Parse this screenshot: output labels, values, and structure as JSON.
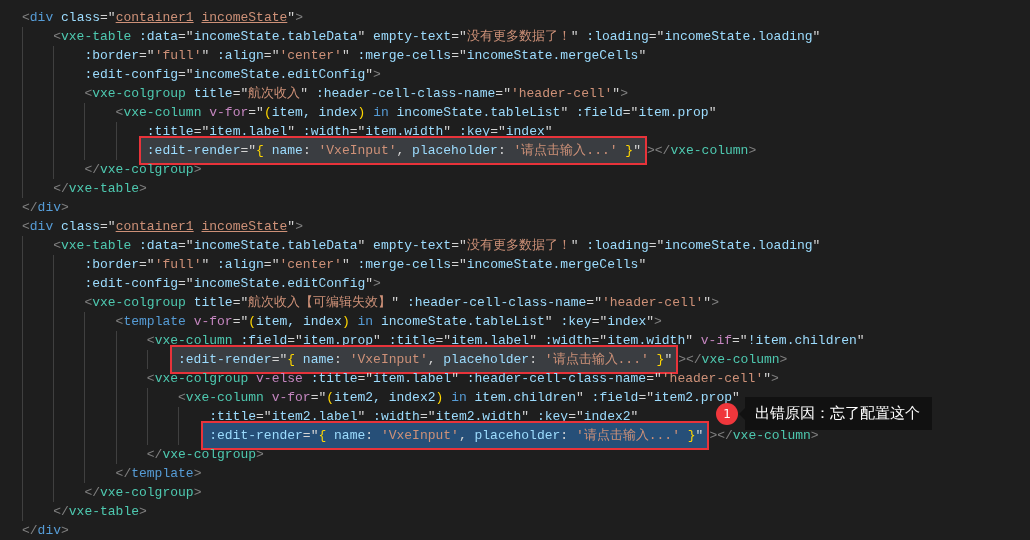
{
  "editor": {
    "lines": [
      {
        "tokens": [
          {
            "kind": "bracket",
            "text": "<"
          },
          {
            "kind": "tag",
            "text": "div"
          },
          {
            "kind": "attr",
            "text": " class"
          },
          {
            "kind": "plain",
            "text": "=\""
          },
          {
            "kind": "string_underlined",
            "text": "container1"
          },
          {
            "kind": "string_underlined",
            "text": " incomeState"
          },
          {
            "kind": "plain",
            "text": "\""
          },
          {
            "kind": "bracket",
            "text": ">"
          }
        ],
        "children": [
          {
            "tokens": [
              {
                "kind": "bracket",
                "text": "<"
              },
              {
                "kind": "component",
                "text": "vxe-table"
              },
              {
                "kind": "attr",
                "text": " :data"
              },
              {
                "kind": "plain",
                "text": "=\""
              },
              {
                "kind": "expr",
                "text": "incomeState.tableData"
              },
              {
                "kind": "plain",
                "text": "\" "
              },
              {
                "kind": "attr",
                "text": "empty-text"
              },
              {
                "kind": "plain",
                "text": "=\""
              },
              {
                "kind": "string",
                "text": "没有更多数据了！"
              },
              {
                "kind": "plain",
                "text": "\" "
              },
              {
                "kind": "attr",
                "text": ":loading"
              },
              {
                "kind": "plain",
                "text": "=\""
              },
              {
                "kind": "expr",
                "text": "incomeState.loading"
              },
              {
                "kind": "plain",
                "text": "\""
              }
            ],
            "children": [
              {
                "tokens": [
                  {
                    "kind": "attr",
                    "text": ":border"
                  },
                  {
                    "kind": "plain",
                    "text": "=\""
                  },
                  {
                    "kind": "string",
                    "text": "'full'"
                  },
                  {
                    "kind": "plain",
                    "text": "\" "
                  },
                  {
                    "kind": "attr",
                    "text": ":align"
                  },
                  {
                    "kind": "plain",
                    "text": "=\""
                  },
                  {
                    "kind": "string",
                    "text": "'center'"
                  },
                  {
                    "kind": "plain",
                    "text": "\" "
                  },
                  {
                    "kind": "attr",
                    "text": ":merge-cells"
                  },
                  {
                    "kind": "plain",
                    "text": "=\""
                  },
                  {
                    "kind": "expr",
                    "text": "incomeState.mergeCells"
                  },
                  {
                    "kind": "plain",
                    "text": "\""
                  }
                ]
              },
              {
                "tokens": [
                  {
                    "kind": "attr",
                    "text": ":edit-config"
                  },
                  {
                    "kind": "plain",
                    "text": "=\""
                  },
                  {
                    "kind": "expr",
                    "text": "incomeState.editConfig"
                  },
                  {
                    "kind": "plain",
                    "text": "\""
                  },
                  {
                    "kind": "bracket",
                    "text": ">"
                  }
                ]
              },
              {
                "tokens": [
                  {
                    "kind": "bracket",
                    "text": "<"
                  },
                  {
                    "kind": "component",
                    "text": "vxe-colgroup"
                  },
                  {
                    "kind": "attr",
                    "text": " title"
                  },
                  {
                    "kind": "plain",
                    "text": "=\""
                  },
                  {
                    "kind": "string",
                    "text": "航次收入"
                  },
                  {
                    "kind": "plain",
                    "text": "\" "
                  },
                  {
                    "kind": "attr",
                    "text": ":header-cell-class-name"
                  },
                  {
                    "kind": "plain",
                    "text": "=\""
                  },
                  {
                    "kind": "string",
                    "text": "'header-cell'"
                  },
                  {
                    "kind": "plain",
                    "text": "\""
                  },
                  {
                    "kind": "bracket",
                    "text": ">"
                  }
                ],
                "children": [
                  {
                    "tokens": [
                      {
                        "kind": "bracket",
                        "text": "<"
                      },
                      {
                        "kind": "component",
                        "text": "vxe-column"
                      },
                      {
                        "kind": "directive",
                        "text": " v-for"
                      },
                      {
                        "kind": "plain",
                        "text": "=\""
                      },
                      {
                        "kind": "brace",
                        "text": "("
                      },
                      {
                        "kind": "expr",
                        "text": "item, index"
                      },
                      {
                        "kind": "brace",
                        "text": ")"
                      },
                      {
                        "kind": "keyword",
                        "text": " in"
                      },
                      {
                        "kind": "expr",
                        "text": " incomeState.tableList"
                      },
                      {
                        "kind": "plain",
                        "text": "\" "
                      },
                      {
                        "kind": "attr",
                        "text": ":field"
                      },
                      {
                        "kind": "plain",
                        "text": "=\""
                      },
                      {
                        "kind": "expr",
                        "text": "item.prop"
                      },
                      {
                        "kind": "plain",
                        "text": "\""
                      }
                    ],
                    "children": [
                      {
                        "tokens": [
                          {
                            "kind": "attr",
                            "text": ":title"
                          },
                          {
                            "kind": "plain",
                            "text": "=\""
                          },
                          {
                            "kind": "expr",
                            "text": "item.label"
                          },
                          {
                            "kind": "plain",
                            "text": "\" "
                          },
                          {
                            "kind": "attr",
                            "text": ":width"
                          },
                          {
                            "kind": "plain",
                            "text": "=\""
                          },
                          {
                            "kind": "expr",
                            "text": "item.width"
                          },
                          {
                            "kind": "plain",
                            "text": "\" "
                          },
                          {
                            "kind": "attr",
                            "text": ":key"
                          },
                          {
                            "kind": "plain",
                            "text": "=\""
                          },
                          {
                            "kind": "expr",
                            "text": "index"
                          },
                          {
                            "kind": "plain",
                            "text": "\""
                          }
                        ]
                      },
                      {
                        "marked": {
                          "selected": false,
                          "tokens": [
                            {
                              "kind": "attr",
                              "text": ":edit-render"
                            },
                            {
                              "kind": "plain",
                              "text": "=\""
                            },
                            {
                              "kind": "brace",
                              "text": "{"
                            },
                            {
                              "kind": "expr",
                              "text": " name"
                            },
                            {
                              "kind": "plain",
                              "text": ": "
                            },
                            {
                              "kind": "string",
                              "text": "'VxeInput'"
                            },
                            {
                              "kind": "plain",
                              "text": ", "
                            },
                            {
                              "kind": "expr",
                              "text": "placeholder"
                            },
                            {
                              "kind": "plain",
                              "text": ": "
                            },
                            {
                              "kind": "string",
                              "text": "'请点击输入...'"
                            },
                            {
                              "kind": "brace",
                              "text": " }"
                            },
                            {
                              "kind": "plain",
                              "text": "\""
                            }
                          ]
                        },
                        "after": [
                          {
                            "kind": "bracket",
                            "text": "></"
                          },
                          {
                            "kind": "component",
                            "text": "vxe-column"
                          },
                          {
                            "kind": "bracket",
                            "text": ">"
                          }
                        ]
                      }
                    ]
                  }
                ]
              },
              {
                "tokens": [
                  {
                    "kind": "bracket",
                    "text": "</"
                  },
                  {
                    "kind": "component",
                    "text": "vxe-colgroup"
                  },
                  {
                    "kind": "bracket",
                    "text": ">"
                  }
                ]
              }
            ]
          },
          {
            "tokens": [
              {
                "kind": "bracket",
                "text": "</"
              },
              {
                "kind": "component",
                "text": "vxe-table"
              },
              {
                "kind": "bracket",
                "text": ">"
              }
            ]
          }
        ]
      },
      {
        "tokens": [
          {
            "kind": "bracket",
            "text": "</"
          },
          {
            "kind": "tag",
            "text": "div"
          },
          {
            "kind": "bracket",
            "text": ">"
          }
        ]
      },
      {
        "tokens": [
          {
            "kind": "bracket",
            "text": "<"
          },
          {
            "kind": "tag",
            "text": "div"
          },
          {
            "kind": "attr",
            "text": " class"
          },
          {
            "kind": "plain",
            "text": "=\""
          },
          {
            "kind": "string_underlined",
            "text": "container1"
          },
          {
            "kind": "string_underlined",
            "text": " incomeState"
          },
          {
            "kind": "plain",
            "text": "\""
          },
          {
            "kind": "bracket",
            "text": ">"
          }
        ],
        "children": [
          {
            "tokens": [
              {
                "kind": "bracket",
                "text": "<"
              },
              {
                "kind": "component",
                "text": "vxe-table"
              },
              {
                "kind": "attr",
                "text": " :data"
              },
              {
                "kind": "plain",
                "text": "=\""
              },
              {
                "kind": "expr",
                "text": "incomeState.tableData"
              },
              {
                "kind": "plain",
                "text": "\" "
              },
              {
                "kind": "attr",
                "text": "empty-text"
              },
              {
                "kind": "plain",
                "text": "=\""
              },
              {
                "kind": "string",
                "text": "没有更多数据了！"
              },
              {
                "kind": "plain",
                "text": "\" "
              },
              {
                "kind": "attr",
                "text": ":loading"
              },
              {
                "kind": "plain",
                "text": "=\""
              },
              {
                "kind": "expr",
                "text": "incomeState.loading"
              },
              {
                "kind": "plain",
                "text": "\""
              }
            ],
            "children": [
              {
                "tokens": [
                  {
                    "kind": "attr",
                    "text": ":border"
                  },
                  {
                    "kind": "plain",
                    "text": "=\""
                  },
                  {
                    "kind": "string",
                    "text": "'full'"
                  },
                  {
                    "kind": "plain",
                    "text": "\" "
                  },
                  {
                    "kind": "attr",
                    "text": ":align"
                  },
                  {
                    "kind": "plain",
                    "text": "=\""
                  },
                  {
                    "kind": "string",
                    "text": "'center'"
                  },
                  {
                    "kind": "plain",
                    "text": "\" "
                  },
                  {
                    "kind": "attr",
                    "text": ":merge-cells"
                  },
                  {
                    "kind": "plain",
                    "text": "=\""
                  },
                  {
                    "kind": "expr",
                    "text": "incomeState.mergeCells"
                  },
                  {
                    "kind": "plain",
                    "text": "\""
                  }
                ]
              },
              {
                "tokens": [
                  {
                    "kind": "attr",
                    "text": ":edit-config"
                  },
                  {
                    "kind": "plain",
                    "text": "=\""
                  },
                  {
                    "kind": "expr",
                    "text": "incomeState.editConfig"
                  },
                  {
                    "kind": "plain",
                    "text": "\""
                  },
                  {
                    "kind": "bracket",
                    "text": ">"
                  }
                ]
              },
              {
                "tokens": [
                  {
                    "kind": "bracket",
                    "text": "<"
                  },
                  {
                    "kind": "component",
                    "text": "vxe-colgroup"
                  },
                  {
                    "kind": "attr",
                    "text": " title"
                  },
                  {
                    "kind": "plain",
                    "text": "=\""
                  },
                  {
                    "kind": "string",
                    "text": "航次收入【可编辑失效】"
                  },
                  {
                    "kind": "plain",
                    "text": "\" "
                  },
                  {
                    "kind": "attr",
                    "text": ":header-cell-class-name"
                  },
                  {
                    "kind": "plain",
                    "text": "=\""
                  },
                  {
                    "kind": "string",
                    "text": "'header-cell'"
                  },
                  {
                    "kind": "plain",
                    "text": "\""
                  },
                  {
                    "kind": "bracket",
                    "text": ">"
                  }
                ],
                "children": [
                  {
                    "tokens": [
                      {
                        "kind": "bracket",
                        "text": "<"
                      },
                      {
                        "kind": "tag",
                        "text": "template"
                      },
                      {
                        "kind": "directive",
                        "text": " v-for"
                      },
                      {
                        "kind": "plain",
                        "text": "=\""
                      },
                      {
                        "kind": "brace",
                        "text": "("
                      },
                      {
                        "kind": "expr",
                        "text": "item, index"
                      },
                      {
                        "kind": "brace",
                        "text": ")"
                      },
                      {
                        "kind": "keyword",
                        "text": " in"
                      },
                      {
                        "kind": "expr",
                        "text": " incomeState.tableList"
                      },
                      {
                        "kind": "plain",
                        "text": "\" "
                      },
                      {
                        "kind": "attr",
                        "text": ":key"
                      },
                      {
                        "kind": "plain",
                        "text": "=\""
                      },
                      {
                        "kind": "expr",
                        "text": "index"
                      },
                      {
                        "kind": "plain",
                        "text": "\""
                      },
                      {
                        "kind": "bracket",
                        "text": ">"
                      }
                    ],
                    "children": [
                      {
                        "tokens": [
                          {
                            "kind": "bracket",
                            "text": "<"
                          },
                          {
                            "kind": "component",
                            "text": "vxe-column"
                          },
                          {
                            "kind": "attr",
                            "text": " :field"
                          },
                          {
                            "kind": "plain",
                            "text": "=\""
                          },
                          {
                            "kind": "expr",
                            "text": "item.prop"
                          },
                          {
                            "kind": "plain",
                            "text": "\" "
                          },
                          {
                            "kind": "attr",
                            "text": ":title"
                          },
                          {
                            "kind": "plain",
                            "text": "=\""
                          },
                          {
                            "kind": "expr",
                            "text": "item.label"
                          },
                          {
                            "kind": "plain",
                            "text": "\" "
                          },
                          {
                            "kind": "attr",
                            "text": ":width"
                          },
                          {
                            "kind": "plain",
                            "text": "=\""
                          },
                          {
                            "kind": "expr",
                            "text": "item.width"
                          },
                          {
                            "kind": "plain",
                            "text": "\" "
                          },
                          {
                            "kind": "directive",
                            "text": "v-if"
                          },
                          {
                            "kind": "plain",
                            "text": "=\""
                          },
                          {
                            "kind": "expr",
                            "text": "!item.children"
                          },
                          {
                            "kind": "plain",
                            "text": "\""
                          }
                        ],
                        "children": [
                          {
                            "marked": {
                              "selected": false,
                              "tokens": [
                                {
                                  "kind": "attr",
                                  "text": ":edit-render"
                                },
                                {
                                  "kind": "plain",
                                  "text": "=\""
                                },
                                {
                                  "kind": "brace",
                                  "text": "{"
                                },
                                {
                                  "kind": "expr",
                                  "text": " name"
                                },
                                {
                                  "kind": "plain",
                                  "text": ": "
                                },
                                {
                                  "kind": "string",
                                  "text": "'VxeInput'"
                                },
                                {
                                  "kind": "plain",
                                  "text": ", "
                                },
                                {
                                  "kind": "expr",
                                  "text": "placeholder"
                                },
                                {
                                  "kind": "plain",
                                  "text": ": "
                                },
                                {
                                  "kind": "string",
                                  "text": "'请点击输入...'"
                                },
                                {
                                  "kind": "brace",
                                  "text": " }"
                                },
                                {
                                  "kind": "plain",
                                  "text": "\""
                                }
                              ]
                            },
                            "after": [
                              {
                                "kind": "bracket",
                                "text": "></"
                              },
                              {
                                "kind": "component",
                                "text": "vxe-column"
                              },
                              {
                                "kind": "bracket",
                                "text": ">"
                              }
                            ]
                          }
                        ]
                      },
                      {
                        "tokens": [
                          {
                            "kind": "bracket",
                            "text": "<"
                          },
                          {
                            "kind": "component",
                            "text": "vxe-colgroup"
                          },
                          {
                            "kind": "directive",
                            "text": " v-else"
                          },
                          {
                            "kind": "attr",
                            "text": " :title"
                          },
                          {
                            "kind": "plain",
                            "text": "=\""
                          },
                          {
                            "kind": "expr",
                            "text": "item.label"
                          },
                          {
                            "kind": "plain",
                            "text": "\" "
                          },
                          {
                            "kind": "attr",
                            "text": ":header-cell-class-name"
                          },
                          {
                            "kind": "plain",
                            "text": "=\""
                          },
                          {
                            "kind": "string",
                            "text": "'header-cell'"
                          },
                          {
                            "kind": "plain",
                            "text": "\""
                          },
                          {
                            "kind": "bracket",
                            "text": ">"
                          }
                        ],
                        "children": [
                          {
                            "tokens": [
                              {
                                "kind": "bracket",
                                "text": "<"
                              },
                              {
                                "kind": "component",
                                "text": "vxe-column"
                              },
                              {
                                "kind": "directive",
                                "text": " v-for"
                              },
                              {
                                "kind": "plain",
                                "text": "=\""
                              },
                              {
                                "kind": "brace",
                                "text": "("
                              },
                              {
                                "kind": "expr",
                                "text": "item2, index2"
                              },
                              {
                                "kind": "brace",
                                "text": ")"
                              },
                              {
                                "kind": "keyword",
                                "text": " in"
                              },
                              {
                                "kind": "expr",
                                "text": " item.children"
                              },
                              {
                                "kind": "plain",
                                "text": "\" "
                              },
                              {
                                "kind": "attr",
                                "text": ":field"
                              },
                              {
                                "kind": "plain",
                                "text": "=\""
                              },
                              {
                                "kind": "expr",
                                "text": "item2.prop"
                              },
                              {
                                "kind": "plain",
                                "text": "\""
                              }
                            ],
                            "children": [
                              {
                                "tokens": [
                                  {
                                    "kind": "attr",
                                    "text": ":title"
                                  },
                                  {
                                    "kind": "plain",
                                    "text": "=\""
                                  },
                                  {
                                    "kind": "expr",
                                    "text": "item2.label"
                                  },
                                  {
                                    "kind": "plain",
                                    "text": "\" "
                                  },
                                  {
                                    "kind": "attr",
                                    "text": ":width"
                                  },
                                  {
                                    "kind": "plain",
                                    "text": "=\""
                                  },
                                  {
                                    "kind": "expr",
                                    "text": "item2.width"
                                  },
                                  {
                                    "kind": "plain",
                                    "text": "\" "
                                  },
                                  {
                                    "kind": "attr",
                                    "text": ":key"
                                  },
                                  {
                                    "kind": "plain",
                                    "text": "=\""
                                  },
                                  {
                                    "kind": "expr",
                                    "text": "index2"
                                  },
                                  {
                                    "kind": "plain",
                                    "text": "\""
                                  }
                                ]
                              },
                              {
                                "marked": {
                                  "selected": true,
                                  "tokens": [
                                    {
                                      "kind": "attr",
                                      "text": ":edit-render"
                                    },
                                    {
                                      "kind": "plain",
                                      "text": "=\""
                                    },
                                    {
                                      "kind": "brace",
                                      "text": "{"
                                    },
                                    {
                                      "kind": "expr",
                                      "text": " name"
                                    },
                                    {
                                      "kind": "plain",
                                      "text": ": "
                                    },
                                    {
                                      "kind": "string",
                                      "text": "'VxeInput'"
                                    },
                                    {
                                      "kind": "plain",
                                      "text": ", "
                                    },
                                    {
                                      "kind": "expr",
                                      "text": "placeholder"
                                    },
                                    {
                                      "kind": "plain",
                                      "text": ": "
                                    },
                                    {
                                      "kind": "string",
                                      "text": "'请点击输入...'"
                                    },
                                    {
                                      "kind": "brace",
                                      "text": " }"
                                    },
                                    {
                                      "kind": "plain",
                                      "text": "\""
                                    }
                                  ]
                                },
                                "after": [
                                  {
                                    "kind": "bracket",
                                    "text": "></"
                                  },
                                  {
                                    "kind": "component",
                                    "text": "vxe-column"
                                  },
                                  {
                                    "kind": "bracket",
                                    "text": ">"
                                  }
                                ]
                              }
                            ]
                          }
                        ]
                      },
                      {
                        "tokens": [
                          {
                            "kind": "bracket",
                            "text": "</"
                          },
                          {
                            "kind": "component",
                            "text": "vxe-colgroup"
                          },
                          {
                            "kind": "bracket",
                            "text": ">"
                          }
                        ]
                      }
                    ]
                  },
                  {
                    "tokens": [
                      {
                        "kind": "bracket",
                        "text": "</"
                      },
                      {
                        "kind": "tag",
                        "text": "template"
                      },
                      {
                        "kind": "bracket",
                        "text": ">"
                      }
                    ]
                  }
                ]
              },
              {
                "tokens": [
                  {
                    "kind": "bracket",
                    "text": "</"
                  },
                  {
                    "kind": "component",
                    "text": "vxe-colgroup"
                  },
                  {
                    "kind": "bracket",
                    "text": ">"
                  }
                ]
              }
            ]
          },
          {
            "tokens": [
              {
                "kind": "bracket",
                "text": "</"
              },
              {
                "kind": "component",
                "text": "vxe-table"
              },
              {
                "kind": "bracket",
                "text": ">"
              }
            ]
          }
        ]
      },
      {
        "tokens": [
          {
            "kind": "bracket",
            "text": "</"
          },
          {
            "kind": "tag",
            "text": "div"
          },
          {
            "kind": "bracket",
            "text": ">"
          }
        ]
      }
    ]
  },
  "annotation": {
    "number": "1",
    "text": "出错原因：忘了配置这个"
  }
}
